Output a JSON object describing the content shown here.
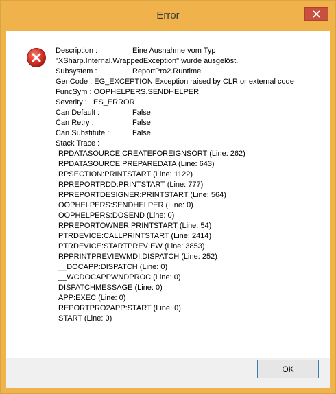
{
  "window": {
    "title": "Error"
  },
  "error": {
    "description_label": "Description :",
    "description_line1": "Eine Ausnahme vom Typ",
    "description_line2": "\"XSharp.Internal.WrappedException\" wurde ausgelöst.",
    "subsystem_label": "Subsystem :",
    "subsystem_value": "ReportPro2.Runtime",
    "gencode_text": "GenCode : EG_EXCEPTION Exception raised by CLR or external code",
    "funcsym_text": "FuncSym : OOPHELPERS.SENDHELPER",
    "severity_text": "Severity :   ES_ERROR",
    "can_default_label": "Can Default :",
    "can_default_value": "False",
    "can_retry_label": "Can Retry :",
    "can_retry_value": "False",
    "can_substitute_label": "Can Substitute :",
    "can_substitute_value": "False",
    "stack_trace_label": "Stack Trace :",
    "stack_trace": [
      "RPDATASOURCE:CREATEFOREIGNSORT (Line: 262)",
      "RPDATASOURCE:PREPAREDATA (Line: 643)",
      "RPSECTION:PRINTSTART (Line: 1122)",
      "RPREPORTRDD:PRINTSTART (Line: 777)",
      "RPREPORTDESIGNER:PRINTSTART (Line: 564)",
      "OOPHELPERS:SENDHELPER (Line: 0)",
      "OOPHELPERS:DOSEND (Line: 0)",
      "RPREPORTOWNER:PRINTSTART (Line: 54)",
      "PTRDEVICE:CALLPRINTSTART (Line: 2414)",
      "PTRDEVICE:STARTPREVIEW (Line: 3853)",
      "RPPRINTPREVIEWMDI:DISPATCH (Line: 252)",
      "__DOCAPP:DISPATCH (Line: 0)",
      "__WCDOCAPPWNDPROC (Line: 0)",
      "DISPATCHMESSAGE (Line: 0)",
      "APP:EXEC (Line: 0)",
      "REPORTPRO2APP:START (Line: 0)",
      "START (Line: 0)"
    ]
  },
  "buttons": {
    "ok_label": "OK"
  },
  "icons": {
    "error": "error-icon",
    "close": "close-icon"
  },
  "colors": {
    "title_bar": "#f0b24b",
    "close_button": "#c7503f",
    "error_icon": "#d9352a",
    "ok_border": "#3c7fb1"
  }
}
